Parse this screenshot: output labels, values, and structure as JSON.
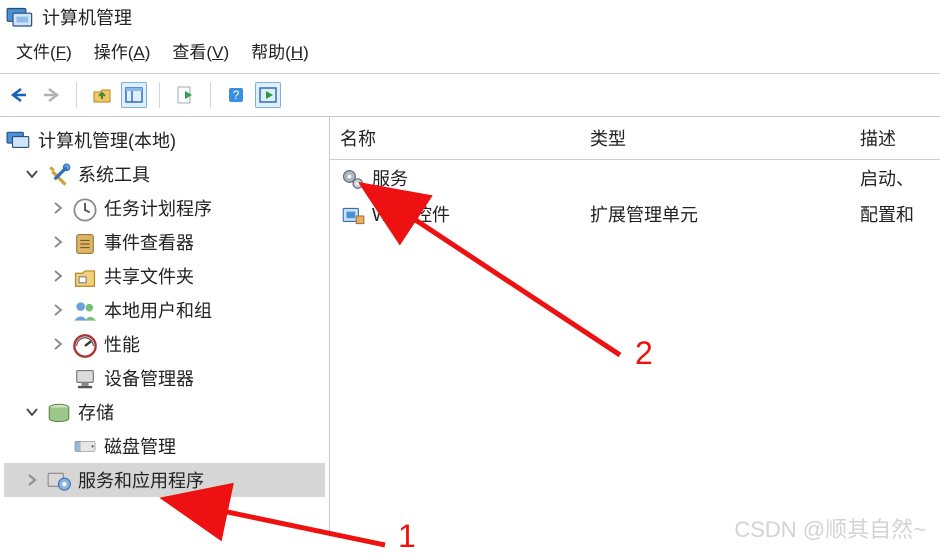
{
  "window": {
    "title": "计算机管理"
  },
  "menu": {
    "file": {
      "label": "文件",
      "hotkey": "F"
    },
    "action": {
      "label": "操作",
      "hotkey": "A"
    },
    "view": {
      "label": "查看",
      "hotkey": "V"
    },
    "help": {
      "label": "帮助",
      "hotkey": "H"
    }
  },
  "toolbar": {
    "back": "back",
    "forward": "forward",
    "up": "up",
    "refresh": "refresh",
    "export": "export",
    "help": "help",
    "run": "run"
  },
  "tree": {
    "root": "计算机管理(本地)",
    "sys": {
      "label": "系统工具",
      "items": [
        "任务计划程序",
        "事件查看器",
        "共享文件夹",
        "本地用户和组",
        "性能",
        "设备管理器"
      ]
    },
    "storage": {
      "label": "存储",
      "disk": "磁盘管理"
    },
    "apps": "服务和应用程序"
  },
  "list": {
    "columns": {
      "name": "名称",
      "type": "类型",
      "desc": "描述"
    },
    "rows": [
      {
        "name": "服务",
        "type": "",
        "desc": "启动、"
      },
      {
        "name": "WMI 控件",
        "type": "扩展管理单元",
        "desc": "配置和"
      }
    ]
  },
  "annotation": {
    "n1": "1",
    "n2": "2"
  },
  "watermark": "CSDN @顺其自然~"
}
